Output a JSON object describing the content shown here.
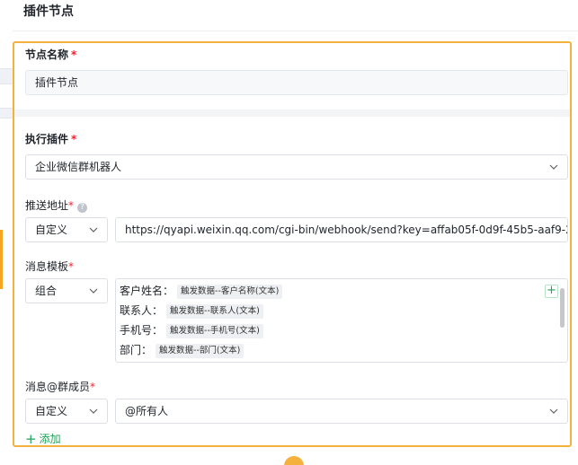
{
  "header": {
    "title": "插件节点"
  },
  "fields": {
    "node_name": {
      "label": "节点名称",
      "value": "插件节点"
    },
    "plugin": {
      "label": "执行插件",
      "value": "企业微信群机器人"
    },
    "push_url": {
      "label": "推送地址",
      "mode": "自定义",
      "value": "https://qyapi.weixin.qq.com/cgi-bin/webhook/send?key=affab05f-0d9f-45b5-aaf9-2..."
    },
    "message_template": {
      "label": "消息模板",
      "mode": "组合",
      "lines": [
        {
          "name": "客户姓名：",
          "tag": "触发数据--客户名称(文本)"
        },
        {
          "name": "联系人：",
          "tag": "触发数据--联系人(文本)"
        },
        {
          "name": "手机号：",
          "tag": "触发数据--手机号(文本)"
        },
        {
          "name": "部门：",
          "tag": "触发数据--部门(文本)"
        }
      ]
    },
    "mention": {
      "label": "消息@群成员",
      "mode": "自定义",
      "value": "@所有人"
    }
  },
  "required_mark": "*",
  "add_label": "添加",
  "colors": {
    "accent_border": "#f5b13d",
    "add_green": "#22a35a",
    "required_red": "#f5222d"
  },
  "icons": {
    "select_arrow": "chevron-down-icon",
    "help": "question-circle-icon",
    "add": "plus-icon"
  }
}
